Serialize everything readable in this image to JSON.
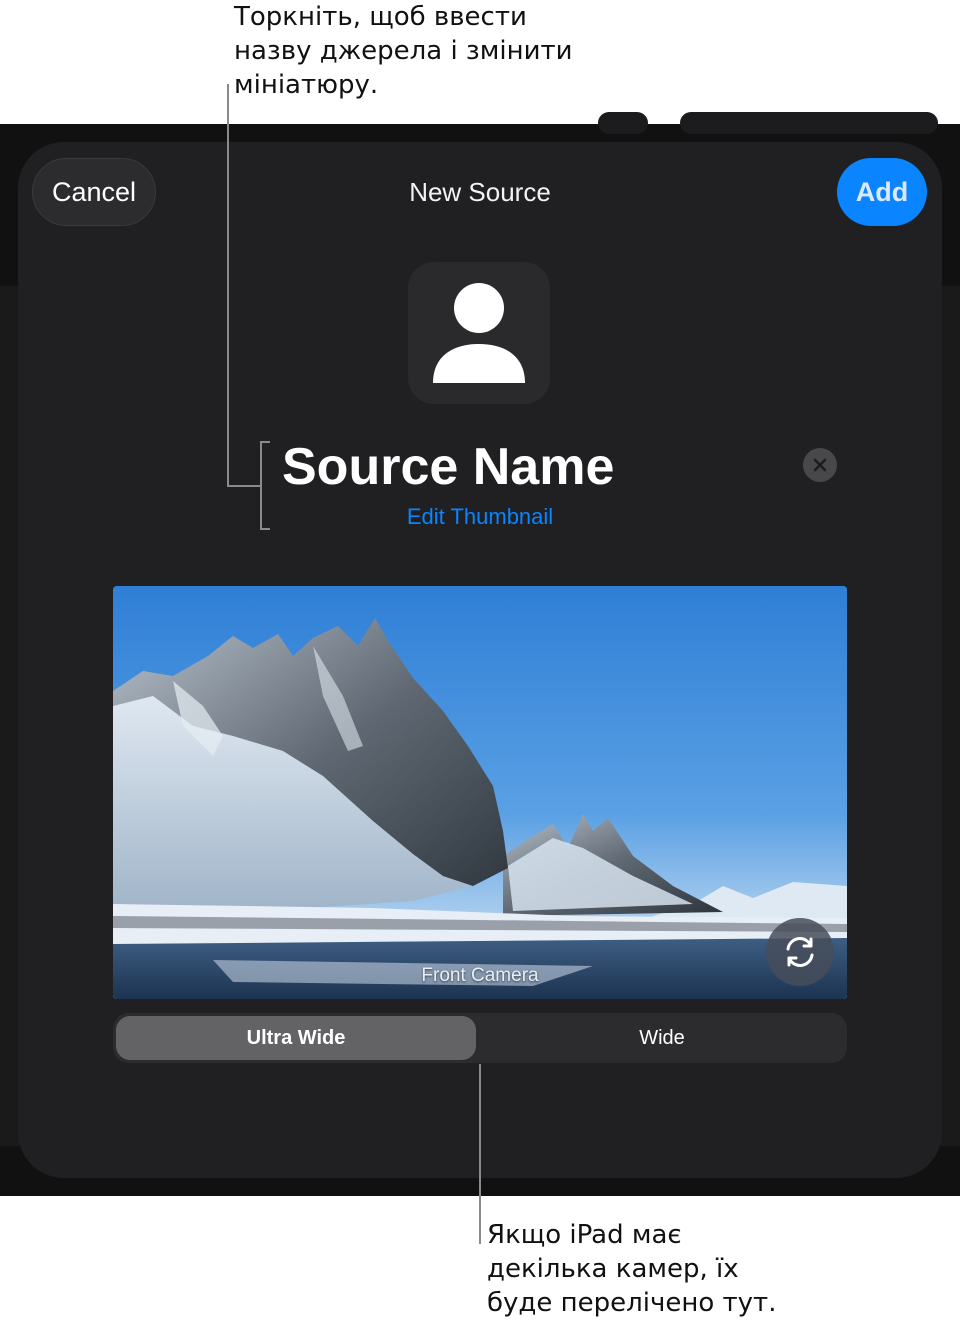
{
  "callouts": {
    "top": [
      "Торкніть, щоб ввести",
      "назву джерела і змінити",
      "мініатюру."
    ],
    "bottom": [
      "Якщо iPad має",
      "декілька камер, їх",
      "буде перелічено тут."
    ]
  },
  "sheet": {
    "cancel_label": "Cancel",
    "title": "New Source",
    "add_label": "Add",
    "source_name_placeholder": "Source Name",
    "edit_thumbnail_label": "Edit Thumbnail",
    "camera_label": "Front Camera",
    "lenses": [
      {
        "label": "Ultra Wide",
        "selected": true
      },
      {
        "label": "Wide",
        "selected": false
      }
    ]
  },
  "icons": {
    "avatar": "person-icon",
    "clear": "clear-x-icon",
    "flip": "camera-flip-icon"
  },
  "colors": {
    "accent": "#0a84ff",
    "sheet_bg": "#202022",
    "backdrop": "#111111"
  }
}
